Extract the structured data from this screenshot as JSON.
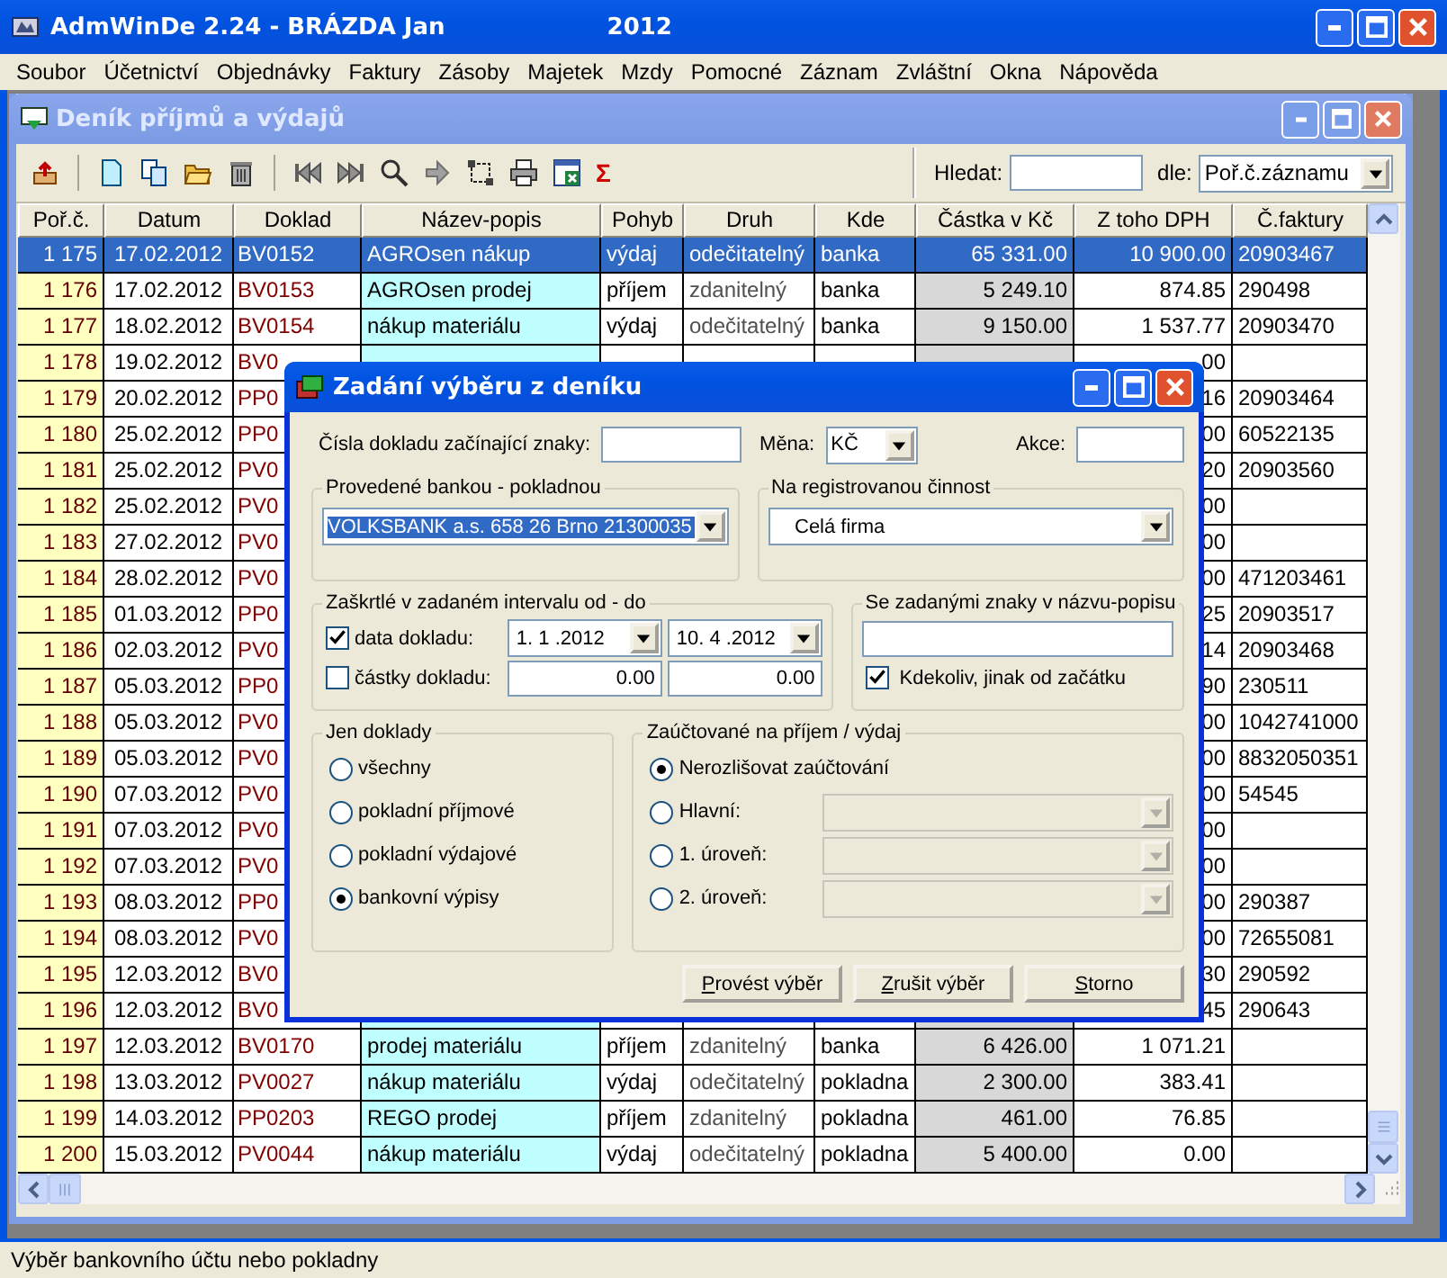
{
  "app_window": {
    "title": "AdmWinDe 2.24 - BRÁZDA Jan",
    "year": "2012"
  },
  "menu": [
    "Soubor",
    "Účetnictví",
    "Objednávky",
    "Faktury",
    "Zásoby",
    "Majetek",
    "Mzdy",
    "Pomocné",
    "Záznam",
    "Zvláštní",
    "Okna",
    "Nápověda"
  ],
  "journal_window": {
    "title": "Deník příjmů a výdajů",
    "sum_symbol": "Σ",
    "search_label": "Hledat:",
    "by_label": "dle:",
    "sort_by": "Poř.č.záznamu"
  },
  "table": {
    "columns": [
      "Poř.č.",
      "Datum",
      "Doklad",
      "Název-popis",
      "Pohyb",
      "Druh",
      "Kde",
      "Částka v Kč",
      "Z toho DPH",
      "Č.faktury"
    ],
    "rows": [
      {
        "number": "1 175",
        "date": "17.02.2012",
        "document": "BV0152",
        "description": "AGROsen nákup",
        "movement": "výdaj",
        "type": "odečitatelný",
        "location": "banka",
        "amount": "65 331.00",
        "vat": "10 900.00",
        "invoice": "20903467",
        "selected": true
      },
      {
        "number": "1 176",
        "date": "17.02.2012",
        "document": "BV0153",
        "description": "AGROsen prodej",
        "movement": "příjem",
        "type": "zdanitelný",
        "location": "banka",
        "amount": "5 249.10",
        "vat": "874.85",
        "invoice": "290498",
        "selected": false
      },
      {
        "number": "1 177",
        "date": "18.02.2012",
        "document": "BV0154",
        "description": "nákup materiálu",
        "movement": "výdaj",
        "type": "odečitatelný",
        "location": "banka",
        "amount": "9 150.00",
        "vat": "1 537.77",
        "invoice": "20903470",
        "selected": false
      },
      {
        "number": "1 178",
        "date": "19.02.2012",
        "document": "BV0",
        "vat": "00",
        "selected": false
      },
      {
        "number": "1 179",
        "date": "20.02.2012",
        "document": "PP0",
        "vat": "16",
        "invoice": "20903464",
        "selected": false
      },
      {
        "number": "1 180",
        "date": "25.02.2012",
        "document": "PP0",
        "vat": "00",
        "invoice": "60522135",
        "selected": false
      },
      {
        "number": "1 181",
        "date": "25.02.2012",
        "document": "PV0",
        "vat": "20",
        "invoice": "20903560",
        "selected": false
      },
      {
        "number": "1 182",
        "date": "25.02.2012",
        "document": "PV0",
        "vat": "00",
        "selected": false
      },
      {
        "number": "1 183",
        "date": "27.02.2012",
        "document": "PV0",
        "vat": "00",
        "selected": false
      },
      {
        "number": "1 184",
        "date": "28.02.2012",
        "document": "PV0",
        "vat": "00",
        "invoice": "471203461",
        "selected": false
      },
      {
        "number": "1 185",
        "date": "01.03.2012",
        "document": "PP0",
        "vat": "25",
        "invoice": "20903517",
        "selected": false
      },
      {
        "number": "1 186",
        "date": "02.03.2012",
        "document": "PV0",
        "vat": "14",
        "invoice": "20903468",
        "selected": false
      },
      {
        "number": "1 187",
        "date": "05.03.2012",
        "document": "PP0",
        "vat": "90",
        "invoice": "230511",
        "selected": false
      },
      {
        "number": "1 188",
        "date": "05.03.2012",
        "document": "PV0",
        "vat": "00",
        "invoice": "1042741000",
        "selected": false
      },
      {
        "number": "1 189",
        "date": "05.03.2012",
        "document": "PV0",
        "vat": "00",
        "invoice": "8832050351",
        "selected": false
      },
      {
        "number": "1 190",
        "date": "07.03.2012",
        "document": "PV0",
        "vat": "00",
        "invoice": "54545",
        "selected": false
      },
      {
        "number": "1 191",
        "date": "07.03.2012",
        "document": "PV0",
        "vat": "00",
        "selected": false
      },
      {
        "number": "1 192",
        "date": "07.03.2012",
        "document": "PV0",
        "vat": "00",
        "selected": false
      },
      {
        "number": "1 193",
        "date": "08.03.2012",
        "document": "PP0",
        "vat": "00",
        "invoice": "290387",
        "selected": false
      },
      {
        "number": "1 194",
        "date": "08.03.2012",
        "document": "PV0",
        "vat": "00",
        "invoice": "72655081",
        "selected": false
      },
      {
        "number": "1 195",
        "date": "12.03.2012",
        "document": "BV0",
        "vat": "30",
        "invoice": "290592",
        "selected": false
      },
      {
        "number": "1 196",
        "date": "12.03.2012",
        "document": "BV0",
        "vat": "45",
        "invoice": "290643",
        "selected": false
      },
      {
        "number": "1 197",
        "date": "12.03.2012",
        "document": "BV0170",
        "description": "prodej materiálu",
        "movement": "příjem",
        "type": "zdanitelný",
        "location": "banka",
        "amount": "6 426.00",
        "vat": "1 071.21",
        "selected": false
      },
      {
        "number": "1 198",
        "date": "13.03.2012",
        "document": "PV0027",
        "description": "nákup materiálu",
        "movement": "výdaj",
        "type": "odečitatelný",
        "location": "pokladna",
        "amount": "2 300.00",
        "vat": "383.41",
        "selected": false
      },
      {
        "number": "1 199",
        "date": "14.03.2012",
        "document": "PP0203",
        "description": "REGO prodej",
        "movement": "příjem",
        "type": "zdanitelný",
        "location": "pokladna",
        "amount": "461.00",
        "vat": "76.85",
        "selected": false
      },
      {
        "number": "1 200",
        "date": "15.03.2012",
        "document": "PV0044",
        "description": "nákup materiálu",
        "movement": "výdaj",
        "type": "odečitatelný",
        "location": "pokladna",
        "amount": "5 400.00",
        "vat": "0.00",
        "selected": false
      }
    ]
  },
  "dialog": {
    "title": "Zadání výběru z deníku",
    "prefix_label": "Čísla dokladu začínající znaky:",
    "currency_label": "Měna:",
    "currency": "KČ",
    "action_label": "Akce:",
    "bank_group": {
      "title": "Provedené bankou - pokladnou",
      "value": "VOLKSBANK a.s. 658 26 Brno 21300035",
      "highlighted": true
    },
    "activity_group": {
      "title": "Na registrovanou činnost",
      "value": "Celá firma"
    },
    "interval_group": {
      "title": "Zaškrtlé v zadaném intervalu od - do",
      "rows": [
        {
          "label": "data dokladu:",
          "checked": true,
          "kind": "dropdown",
          "from": "1. 1 .2012",
          "to": "10. 4 .2012"
        },
        {
          "label": "částky dokladu:",
          "checked": false,
          "kind": "field",
          "from": "0.00",
          "to": "0.00"
        }
      ]
    },
    "text_group": {
      "title": "Se zadanými znaky v názvu-popisu",
      "option": {
        "label": "Kdekoliv, jinak od začátku",
        "checked": true
      }
    },
    "document_group": {
      "title": "Jen doklady",
      "options": [
        {
          "label": "všechny",
          "selected": false
        },
        {
          "label": "pokladní příjmové",
          "selected": false
        },
        {
          "label": "pokladní výdajové",
          "selected": false
        },
        {
          "label": "bankovní výpisy",
          "selected": true
        }
      ]
    },
    "posting_group": {
      "title": "Zaúčtované na příjem / výdaj",
      "options": [
        {
          "label": "Nerozlišovat zaúčtování",
          "selected": true,
          "kind": "plain"
        },
        {
          "label": "Hlavní:",
          "selected": false,
          "kind": "dropdown",
          "disabled": true
        },
        {
          "label": "1. úroveň:",
          "selected": false,
          "kind": "dropdown",
          "disabled": true
        },
        {
          "label": "2. úroveň:",
          "selected": false,
          "kind": "dropdown",
          "disabled": true
        }
      ]
    },
    "buttons": [
      "Provést výběr",
      "Zrušit výběr",
      "Storno"
    ]
  },
  "status_bar": "Výběr bankovního účtu nebo pokladny"
}
